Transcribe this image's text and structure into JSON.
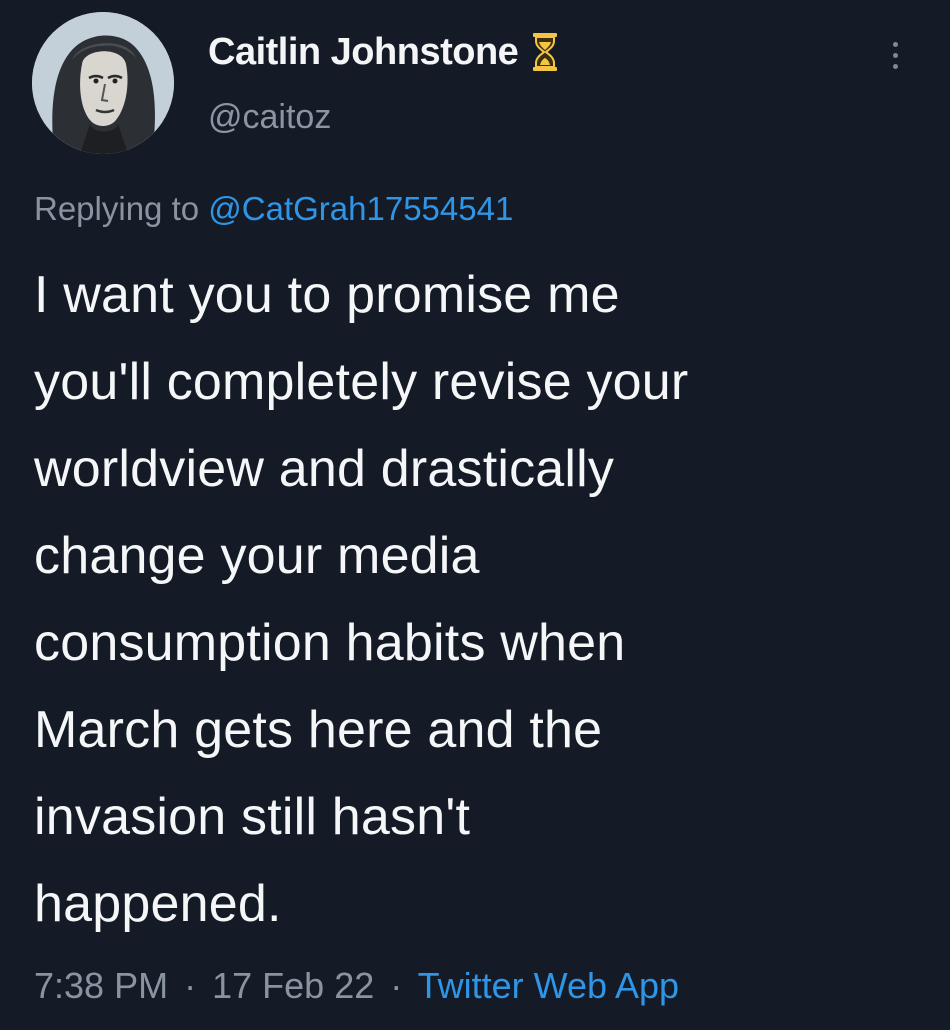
{
  "author": {
    "display_name": "Caitlin Johnstone",
    "handle": "@caitoz",
    "badge_icon": "hourglass-icon",
    "avatar_icon": "profile-portrait"
  },
  "reply": {
    "prefix": "Replying to",
    "mention": "@CatGrah17554541"
  },
  "tweet": {
    "lines": [
      "I want you to promise me",
      "you'll completely revise your",
      "worldview and drastically",
      "change your media",
      "consumption habits when",
      "March gets here and the",
      "invasion still hasn't",
      "happened."
    ]
  },
  "meta": {
    "time": "7:38 PM",
    "separator": "·",
    "date": "17 Feb 22",
    "source": "Twitter Web App"
  },
  "colors": {
    "background": "#151b26",
    "text": "#f4f6f8",
    "muted": "#8a94a1",
    "link": "#2f95e6",
    "badge": "#f4c542"
  },
  "menu": {
    "icon": "more-vertical-icon"
  }
}
